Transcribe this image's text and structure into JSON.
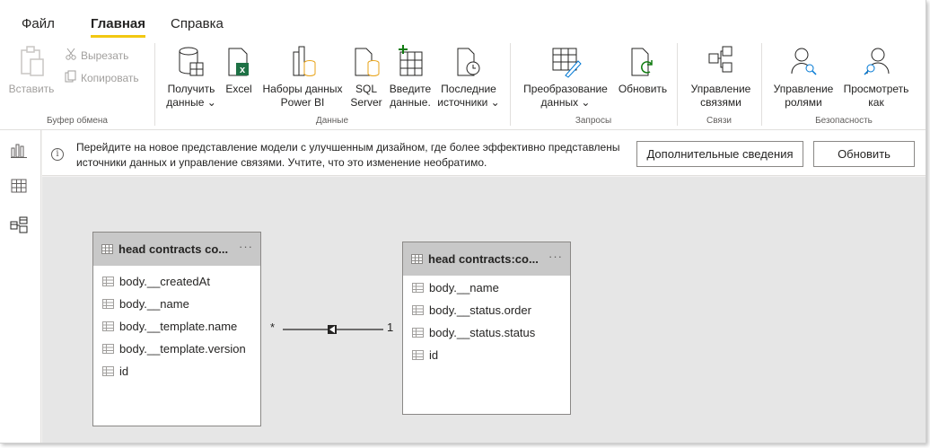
{
  "tabs": [
    "Файл",
    "Главная",
    "Справка"
  ],
  "clipboard": {
    "paste": "Вставить",
    "cut": "Вырезать",
    "copy": "Копировать",
    "group": "Буфер обмена"
  },
  "data_group": {
    "get_data": [
      "Получить",
      "данные ⌄"
    ],
    "excel": "Excel",
    "datasets": [
      "Наборы данных",
      "Power BI"
    ],
    "sql": [
      "SQL",
      "Server"
    ],
    "enter_data": [
      "Введите",
      "данные."
    ],
    "recent": [
      "Последние",
      "источники ⌄"
    ],
    "group": "Данные"
  },
  "queries_group": {
    "transform": [
      "Преобразование",
      "данных ⌄"
    ],
    "refresh": "Обновить",
    "group": "Запросы"
  },
  "relations_group": {
    "manage": [
      "Управление",
      "связями"
    ],
    "group": "Связи"
  },
  "security_group": {
    "manage_roles": [
      "Управление",
      "ролями"
    ],
    "view_as": [
      "Просмотреть",
      "как"
    ],
    "group": "Безопасность"
  },
  "banner": {
    "text": "Перейдите на новое представление модели с улучшенным дизайном, где более эффективно представлены источники данных и управление связями. Учтите, что это изменение необратимо.",
    "more_button": "Дополнительные сведения",
    "refresh_button": "Обновить"
  },
  "tables": [
    {
      "name": "head contracts co...",
      "fields": [
        "body.__createdAt",
        "body.__name",
        "body.__template.name",
        "body.__template.version",
        "id"
      ]
    },
    {
      "name": "head contracts:co...",
      "fields": [
        "body.__name",
        "body.__status.order",
        "body.__status.status",
        "id"
      ]
    }
  ],
  "relationship": {
    "from_cardinality": "*",
    "to_cardinality": "1"
  },
  "colors": {
    "accent": "#f2c811",
    "excel_green": "#1e7145",
    "table_header": "#c8c8c8",
    "canvas": "#e6e6e6"
  }
}
